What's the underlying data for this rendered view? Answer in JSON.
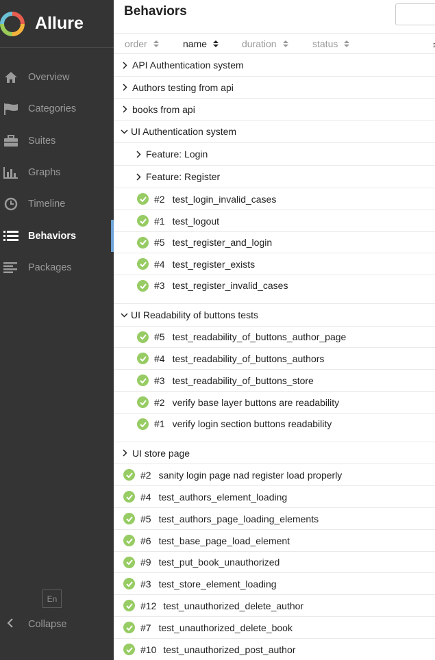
{
  "app": {
    "name": "Allure",
    "lang": "En",
    "collapse_label": "Collapse"
  },
  "sidebar": {
    "items": [
      {
        "label": "Overview",
        "icon": "home-icon"
      },
      {
        "label": "Categories",
        "icon": "flag-icon"
      },
      {
        "label": "Suites",
        "icon": "briefcase-icon"
      },
      {
        "label": "Graphs",
        "icon": "bar-chart-icon"
      },
      {
        "label": "Timeline",
        "icon": "clock-icon"
      },
      {
        "label": "Behaviors",
        "icon": "list-icon",
        "active": true
      },
      {
        "label": "Packages",
        "icon": "align-left-icon"
      }
    ]
  },
  "main": {
    "title": "Behaviors",
    "columns": {
      "order": "order",
      "name": "name",
      "duration": "duration",
      "status": "status"
    },
    "groups": {
      "g1": "API Authentication system",
      "g2": "Authors testing from api",
      "g3": "books from api",
      "g4": "UI Authentication system",
      "g4a": "Feature: Login",
      "g4b": "Feature: Register",
      "g5": "UI Readability of buttons tests",
      "g6": "UI store page"
    },
    "tests_auth": [
      {
        "num": "#2",
        "name": "test_login_invalid_cases"
      },
      {
        "num": "#1",
        "name": "test_logout"
      },
      {
        "num": "#5",
        "name": "test_register_and_login"
      },
      {
        "num": "#4",
        "name": "test_register_exists"
      },
      {
        "num": "#3",
        "name": "test_register_invalid_cases"
      }
    ],
    "tests_read": [
      {
        "num": "#5",
        "name": "test_readability_of_buttons_author_page"
      },
      {
        "num": "#4",
        "name": "test_readability_of_buttons_authors"
      },
      {
        "num": "#3",
        "name": "test_readability_of_buttons_store"
      },
      {
        "num": "#2",
        "name": "verify base layer buttons are readability"
      },
      {
        "num": "#1",
        "name": "verify login section buttons readability"
      }
    ],
    "tests_store": [
      {
        "num": "#2",
        "name": "sanity login page nad register load properly"
      },
      {
        "num": "#4",
        "name": "test_authors_element_loading"
      },
      {
        "num": "#5",
        "name": "test_authors_page_loading_elements"
      },
      {
        "num": "#6",
        "name": "test_base_page_load_element"
      },
      {
        "num": "#9",
        "name": "test_put_book_unauthorized"
      },
      {
        "num": "#3",
        "name": "test_store_element_loading"
      },
      {
        "num": "#12",
        "name": "test_unauthorized_delete_author"
      },
      {
        "num": "#7",
        "name": "test_unauthorized_delete_book"
      },
      {
        "num": "#10",
        "name": "test_unauthorized_post_author"
      }
    ]
  },
  "colors": {
    "sidebar": "#343434",
    "passed": "#97cc64",
    "active_indicator": "#6ea4d6"
  }
}
